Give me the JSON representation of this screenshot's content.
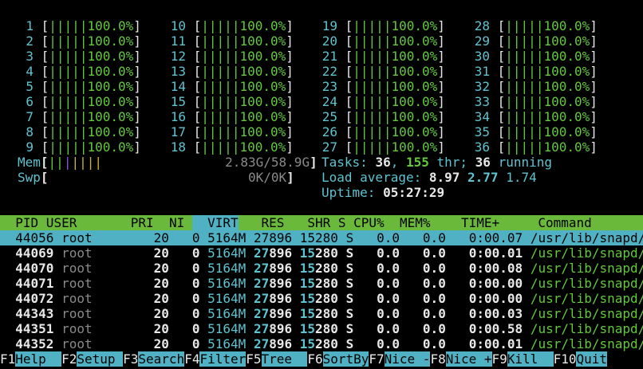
{
  "cpus": [
    {
      "n": "1",
      "pct": "100.0%"
    },
    {
      "n": "2",
      "pct": "100.0%"
    },
    {
      "n": "3",
      "pct": "100.0%"
    },
    {
      "n": "4",
      "pct": "100.0%"
    },
    {
      "n": "5",
      "pct": "100.0%"
    },
    {
      "n": "6",
      "pct": "100.0%"
    },
    {
      "n": "7",
      "pct": "100.0%"
    },
    {
      "n": "8",
      "pct": "100.0%"
    },
    {
      "n": "9",
      "pct": "100.0%"
    },
    {
      "n": "10",
      "pct": "100.0%"
    },
    {
      "n": "11",
      "pct": "100.0%"
    },
    {
      "n": "12",
      "pct": "100.0%"
    },
    {
      "n": "13",
      "pct": "100.0%"
    },
    {
      "n": "14",
      "pct": "100.0%"
    },
    {
      "n": "15",
      "pct": "100.0%"
    },
    {
      "n": "16",
      "pct": "100.0%"
    },
    {
      "n": "17",
      "pct": "100.0%"
    },
    {
      "n": "18",
      "pct": "100.0%"
    },
    {
      "n": "19",
      "pct": "100.0%"
    },
    {
      "n": "20",
      "pct": "100.0%"
    },
    {
      "n": "21",
      "pct": "100.0%"
    },
    {
      "n": "22",
      "pct": "100.0%"
    },
    {
      "n": "23",
      "pct": "100.0%"
    },
    {
      "n": "24",
      "pct": "100.0%"
    },
    {
      "n": "25",
      "pct": "100.0%"
    },
    {
      "n": "26",
      "pct": "100.0%"
    },
    {
      "n": "27",
      "pct": "100.0%"
    },
    {
      "n": "28",
      "pct": "100.0%"
    },
    {
      "n": "29",
      "pct": "100.0%"
    },
    {
      "n": "30",
      "pct": "100.0%"
    },
    {
      "n": "31",
      "pct": "100.0%"
    },
    {
      "n": "32",
      "pct": "100.0%"
    },
    {
      "n": "33",
      "pct": "100.0%"
    },
    {
      "n": "34",
      "pct": "100.0%"
    },
    {
      "n": "35",
      "pct": "100.0%"
    },
    {
      "n": "36",
      "pct": "100.0%"
    }
  ],
  "mem": {
    "label": "Mem",
    "value": "2.83G/58.9G"
  },
  "swp": {
    "label": "Swp",
    "value": "0K/0K"
  },
  "tasks": {
    "label": "Tasks: ",
    "count": "36",
    "sep1": ", ",
    "thr": "155",
    "thr_label": " thr; ",
    "running": "36",
    "running_label": " running"
  },
  "load": {
    "label": "Load average: ",
    "l1": "8.97",
    "l5": "2.77",
    "l15": "1.74"
  },
  "uptime": {
    "label": "Uptime: ",
    "value": "05:27:29"
  },
  "columns": {
    "pid": "  PID",
    "user": " USER     ",
    "pri": "  PRI",
    "ni": "  NI",
    "virt": "  VIRT",
    "res": "   RES",
    "shr": "   SHR",
    "s": " S",
    "cpu": " CPU%",
    "mem": " MEM%",
    "time": "   TIME+  ",
    "cmd": "Command"
  },
  "processes": [
    {
      "pid": "44056",
      "user": "root",
      "pri": "20",
      "ni": "0",
      "virt": "5164M",
      "res": "27896",
      "shr": "15280",
      "s": "S",
      "cpu": "0.0",
      "mem": "0.0",
      "time": "0:00.07",
      "cmd": "/usr/lib/snapd/"
    },
    {
      "pid": "44069",
      "user": "root",
      "pri": "20",
      "ni": "0",
      "virt": "5164M",
      "res": "27896",
      "shr": "15280",
      "s": "S",
      "cpu": "0.0",
      "mem": "0.0",
      "time": "0:00.01",
      "cmd": "/usr/lib/snapd/"
    },
    {
      "pid": "44070",
      "user": "root",
      "pri": "20",
      "ni": "0",
      "virt": "5164M",
      "res": "27896",
      "shr": "15280",
      "s": "S",
      "cpu": "0.0",
      "mem": "0.0",
      "time": "0:00.08",
      "cmd": "/usr/lib/snapd/"
    },
    {
      "pid": "44071",
      "user": "root",
      "pri": "20",
      "ni": "0",
      "virt": "5164M",
      "res": "27896",
      "shr": "15280",
      "s": "S",
      "cpu": "0.0",
      "mem": "0.0",
      "time": "0:00.00",
      "cmd": "/usr/lib/snapd/"
    },
    {
      "pid": "44072",
      "user": "root",
      "pri": "20",
      "ni": "0",
      "virt": "5164M",
      "res": "27896",
      "shr": "15280",
      "s": "S",
      "cpu": "0.0",
      "mem": "0.0",
      "time": "0:00.00",
      "cmd": "/usr/lib/snapd/"
    },
    {
      "pid": "44343",
      "user": "root",
      "pri": "20",
      "ni": "0",
      "virt": "5164M",
      "res": "27896",
      "shr": "15280",
      "s": "S",
      "cpu": "0.0",
      "mem": "0.0",
      "time": "0:00.03",
      "cmd": "/usr/lib/snapd/"
    },
    {
      "pid": "44351",
      "user": "root",
      "pri": "20",
      "ni": "0",
      "virt": "5164M",
      "res": "27896",
      "shr": "15280",
      "s": "S",
      "cpu": "0.0",
      "mem": "0.0",
      "time": "0:00.58",
      "cmd": "/usr/lib/snapd/"
    },
    {
      "pid": "44352",
      "user": "root",
      "pri": "20",
      "ni": "0",
      "virt": "5164M",
      "res": "27896",
      "shr": "15280",
      "s": "S",
      "cpu": "0.0",
      "mem": "0.0",
      "time": "0:00.01",
      "cmd": "/usr/lib/snapd/"
    }
  ],
  "fkeys": [
    {
      "key": "F1",
      "label": "Help  "
    },
    {
      "key": "F2",
      "label": "Setup "
    },
    {
      "key": "F3",
      "label": "Search"
    },
    {
      "key": "F4",
      "label": "Filter"
    },
    {
      "key": "F5",
      "label": "Tree  "
    },
    {
      "key": "F6",
      "label": "SortBy"
    },
    {
      "key": "F7",
      "label": "Nice -"
    },
    {
      "key": "F8",
      "label": "Nice +"
    },
    {
      "key": "F9",
      "label": "Kill  "
    },
    {
      "key": "F10",
      "label": "Quit"
    }
  ]
}
